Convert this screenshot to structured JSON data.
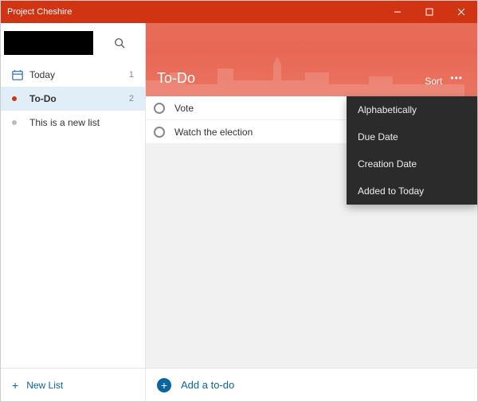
{
  "window": {
    "title": "Project Cheshire"
  },
  "colors": {
    "accent": "#d13413",
    "link": "#0a64a0",
    "menu_bg": "#2b2b2b"
  },
  "sidebar": {
    "lists": [
      {
        "icon": "today",
        "label": "Today",
        "count": "1",
        "selected": false
      },
      {
        "icon": "dot-red",
        "label": "To-Do",
        "count": "2",
        "selected": true
      },
      {
        "icon": "dot-gray",
        "label": "This is a new list",
        "count": "",
        "selected": false
      }
    ],
    "new_list_label": "New List"
  },
  "main": {
    "title": "To-Do",
    "sort_label": "Sort",
    "tasks": [
      {
        "title": "Vote",
        "done": false
      },
      {
        "title": "Watch the election",
        "done": false
      }
    ],
    "add_placeholder": "Add a to-do"
  },
  "sort_menu": {
    "items": [
      "Alphabetically",
      "Due Date",
      "Creation Date",
      "Added to Today"
    ]
  }
}
